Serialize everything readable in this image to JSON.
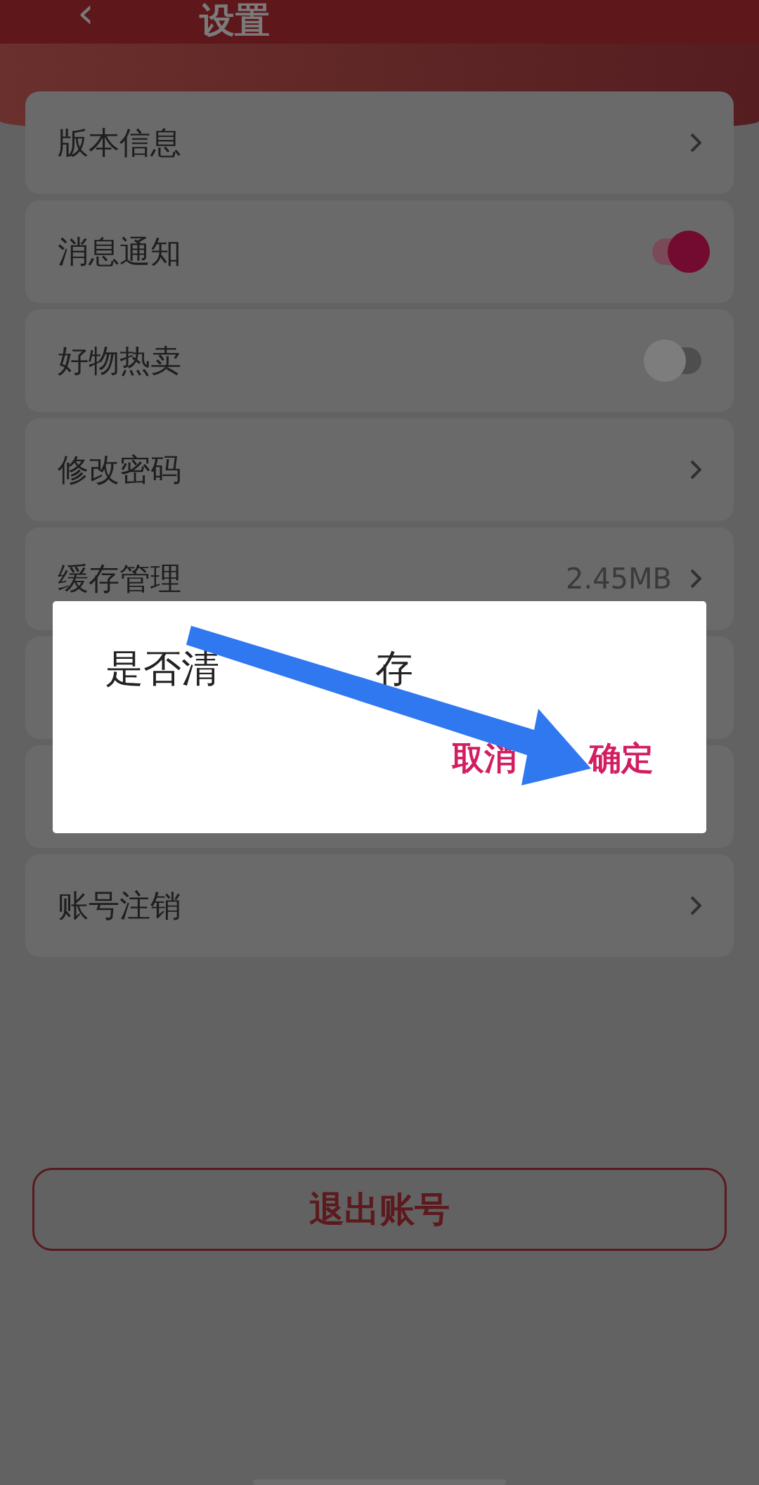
{
  "header": {
    "back_icon": "‹",
    "title": "设置"
  },
  "rows": [
    {
      "kind": "link",
      "label": "版本信息"
    },
    {
      "kind": "toggle",
      "label": "消息通知",
      "on": true
    },
    {
      "kind": "toggle",
      "label": "好物热卖",
      "on": false
    },
    {
      "kind": "link",
      "label": "修改密码"
    },
    {
      "kind": "value",
      "label": "缓存管理",
      "value": "2.45MB"
    },
    {
      "kind": "covered"
    },
    {
      "kind": "covered"
    },
    {
      "kind": "link",
      "label": "账号注销"
    }
  ],
  "logout_button": "退出账号",
  "dialog": {
    "message_parts": [
      "是否清",
      "存"
    ],
    "buttons": [
      "取消",
      "确定"
    ]
  }
}
